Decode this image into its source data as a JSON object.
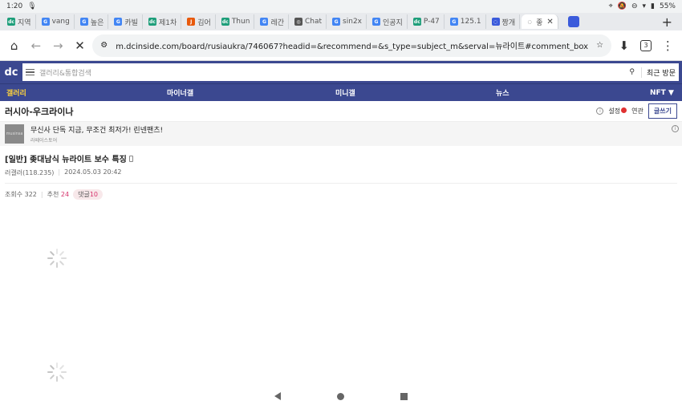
{
  "status": {
    "time": "1:20",
    "battery": "55%"
  },
  "tabs": [
    {
      "label": "지역",
      "fav": "dc",
      "color": "#1e9e7a"
    },
    {
      "label": "vang",
      "fav": "G",
      "color": "#4285f4"
    },
    {
      "label": "높은",
      "fav": "G",
      "color": "#4285f4"
    },
    {
      "label": "카빌",
      "fav": "G",
      "color": "#4285f4"
    },
    {
      "label": "제1차",
      "fav": "dc",
      "color": "#1e9e7a"
    },
    {
      "label": "김어",
      "fav": "J",
      "color": "#e8590c"
    },
    {
      "label": "Thun",
      "fav": "dc",
      "color": "#1e9e7a"
    },
    {
      "label": "레간",
      "fav": "G",
      "color": "#4285f4"
    },
    {
      "label": "Chat",
      "fav": "◎",
      "color": "#555555"
    },
    {
      "label": "sin2x",
      "fav": "G",
      "color": "#4285f4"
    },
    {
      "label": "인공지",
      "fav": "G",
      "color": "#4285f4"
    },
    {
      "label": "P-47",
      "fav": "dc",
      "color": "#1e9e7a"
    },
    {
      "label": "125.1",
      "fav": "G",
      "color": "#4285f4"
    },
    {
      "label": "짱개",
      "fav": "◌",
      "color": "#3b5bdb"
    }
  ],
  "active_tab": {
    "label": "좋",
    "close": "✕"
  },
  "address": {
    "url": "m.dcinside.com/board/rusiaukra/746067?headid=&recommend=&s_type=subject_m&serval=뉴라이트#comment_box",
    "tab_count": "3"
  },
  "dc": {
    "logo": "dc",
    "search_placeholder": "갤러리&통합검색",
    "recent_label": "최근 방문",
    "nav": [
      "갤러리",
      "마이너갤",
      "미니갤",
      "뉴스",
      "NFT ▼"
    ]
  },
  "gallery": {
    "title": "러시아-우크라이나",
    "settings_label": "설정",
    "related_label": "연관",
    "write_label": "글쓰기"
  },
  "ad": {
    "thumb_text": "musinsa",
    "text": "무신사 단독 지금, 무조건 최저가! 린넨팬츠!",
    "source": "라떼이스토어"
  },
  "post": {
    "title": "[일반] 좆대남식 뉴라이트 보수 특징",
    "author": "러갤러(118.235)",
    "date": "2024.05.03 20:42",
    "views_label": "조회수 322",
    "rec_label": "추천",
    "rec_value": "24",
    "comments_label": "댓글",
    "comments_value": "10"
  },
  "accent": "#3b4890",
  "nav_highlight": "#ffd43b"
}
